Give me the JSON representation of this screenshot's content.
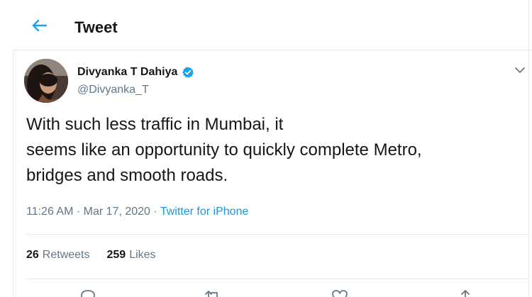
{
  "header": {
    "back_icon": "arrow-left-icon",
    "title": "Tweet"
  },
  "author": {
    "name": "Divyanka T Dahiya",
    "handle": "@Divyanka_T",
    "verified_icon": "verified-badge-icon",
    "more_icon": "chevron-down-icon"
  },
  "tweet": {
    "lines": [
      "With such less traffic in Mumbai, it",
      "seems like an opportunity to quickly complete Metro,",
      "bridges and smooth roads."
    ]
  },
  "meta": {
    "time": "11:26 AM",
    "separator": " · ",
    "date": "Mar 17, 2020",
    "source": "Twitter for iPhone"
  },
  "stats": {
    "retweets_count": "26",
    "retweets_label": "Retweets",
    "likes_count": "259",
    "likes_label": "Likes"
  },
  "actions": [
    {
      "icon": "reply-icon"
    },
    {
      "icon": "retweet-icon"
    },
    {
      "icon": "like-icon"
    },
    {
      "icon": "share-icon"
    }
  ],
  "colors": {
    "accent": "#1da1f2",
    "link": "#1b95e0",
    "text": "#14171a",
    "secondary": "#657786",
    "border": "#e6ecf0"
  }
}
